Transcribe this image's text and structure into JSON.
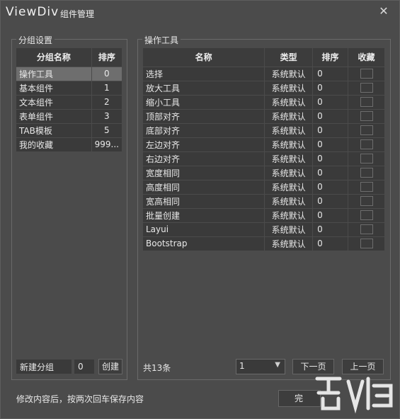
{
  "window": {
    "app_name": "ViewDiv",
    "title": "组件管理",
    "close_icon": "✕"
  },
  "left_group": {
    "legend": "分组设置",
    "headers": [
      "分组名称",
      "排序"
    ],
    "rows": [
      {
        "name": "操作工具",
        "order": "0",
        "selected": true
      },
      {
        "name": "基本组件",
        "order": "1"
      },
      {
        "name": "文本组件",
        "order": "2"
      },
      {
        "name": "表单组件",
        "order": "3"
      },
      {
        "name": "TAB模板",
        "order": "5"
      },
      {
        "name": "我的收藏",
        "order": "999..."
      }
    ],
    "new_group_placeholder": "新建分组",
    "new_group_order": "0",
    "create_label": "创建"
  },
  "right_group": {
    "legend": "操作工具",
    "headers": [
      "名称",
      "类型",
      "排序",
      "收藏"
    ],
    "rows": [
      {
        "name": "选择",
        "type": "系统默认",
        "order": "0"
      },
      {
        "name": "放大工具",
        "type": "系统默认",
        "order": "0"
      },
      {
        "name": "缩小工具",
        "type": "系统默认",
        "order": "0"
      },
      {
        "name": "顶部对齐",
        "type": "系统默认",
        "order": "0"
      },
      {
        "name": "底部对齐",
        "type": "系统默认",
        "order": "0"
      },
      {
        "name": "左边对齐",
        "type": "系统默认",
        "order": "0"
      },
      {
        "name": "右边对齐",
        "type": "系统默认",
        "order": "0"
      },
      {
        "name": "宽度相同",
        "type": "系统默认",
        "order": "0"
      },
      {
        "name": "高度相同",
        "type": "系统默认",
        "order": "0"
      },
      {
        "name": "宽高相同",
        "type": "系统默认",
        "order": "0"
      },
      {
        "name": "批量创建",
        "type": "系统默认",
        "order": "0"
      },
      {
        "name": "Layui",
        "type": "系统默认",
        "order": "0"
      },
      {
        "name": "Bootstrap",
        "type": "系统默认",
        "order": "0"
      }
    ],
    "total_label": "共13条",
    "page_value": "1",
    "next_label": "下一页",
    "prev_label": "上一页"
  },
  "footer": {
    "hint": "修改内容后，按两次回车保存内容",
    "done_label": "完"
  },
  "colors": {
    "background": "#4b4b4b",
    "cell": "#3a3a3a",
    "selected": "#6e6e6e"
  }
}
